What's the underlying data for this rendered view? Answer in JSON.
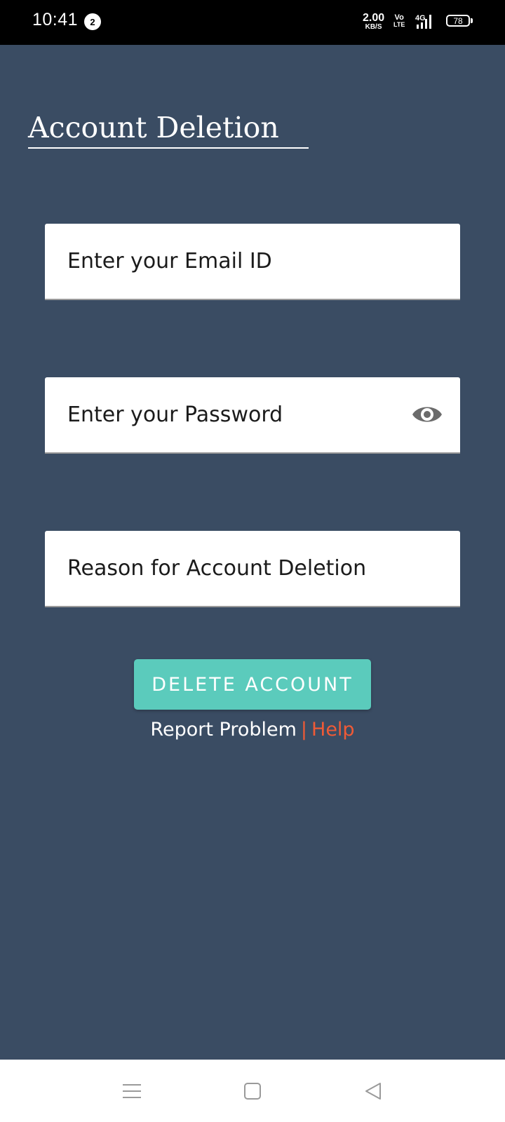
{
  "status_bar": {
    "time": "10:41",
    "notification_count": "2",
    "net_speed_value": "2.00",
    "net_speed_unit": "KB/S",
    "volte_top": "Vo",
    "volte_bottom": "LTE",
    "network_type": "4G",
    "battery_level": "78"
  },
  "page": {
    "title": "Account Deletion"
  },
  "form": {
    "email_placeholder": "Enter your Email ID",
    "email_value": "",
    "password_placeholder": "Enter your Password",
    "password_value": "",
    "reason_placeholder": "Reason for Account Deletion",
    "reason_value": ""
  },
  "actions": {
    "delete_label": "DELETE ACCOUNT"
  },
  "links": {
    "report_label": "Report Problem",
    "separator": "|",
    "help_label": "Help"
  },
  "colors": {
    "background": "#3a4c63",
    "button": "#5bcbbc",
    "help_link": "#f05a36"
  },
  "icons": {
    "password_toggle": "eye-icon",
    "nav_menu": "menu-icon",
    "nav_home": "home-square-icon",
    "nav_back": "back-triangle-icon"
  }
}
